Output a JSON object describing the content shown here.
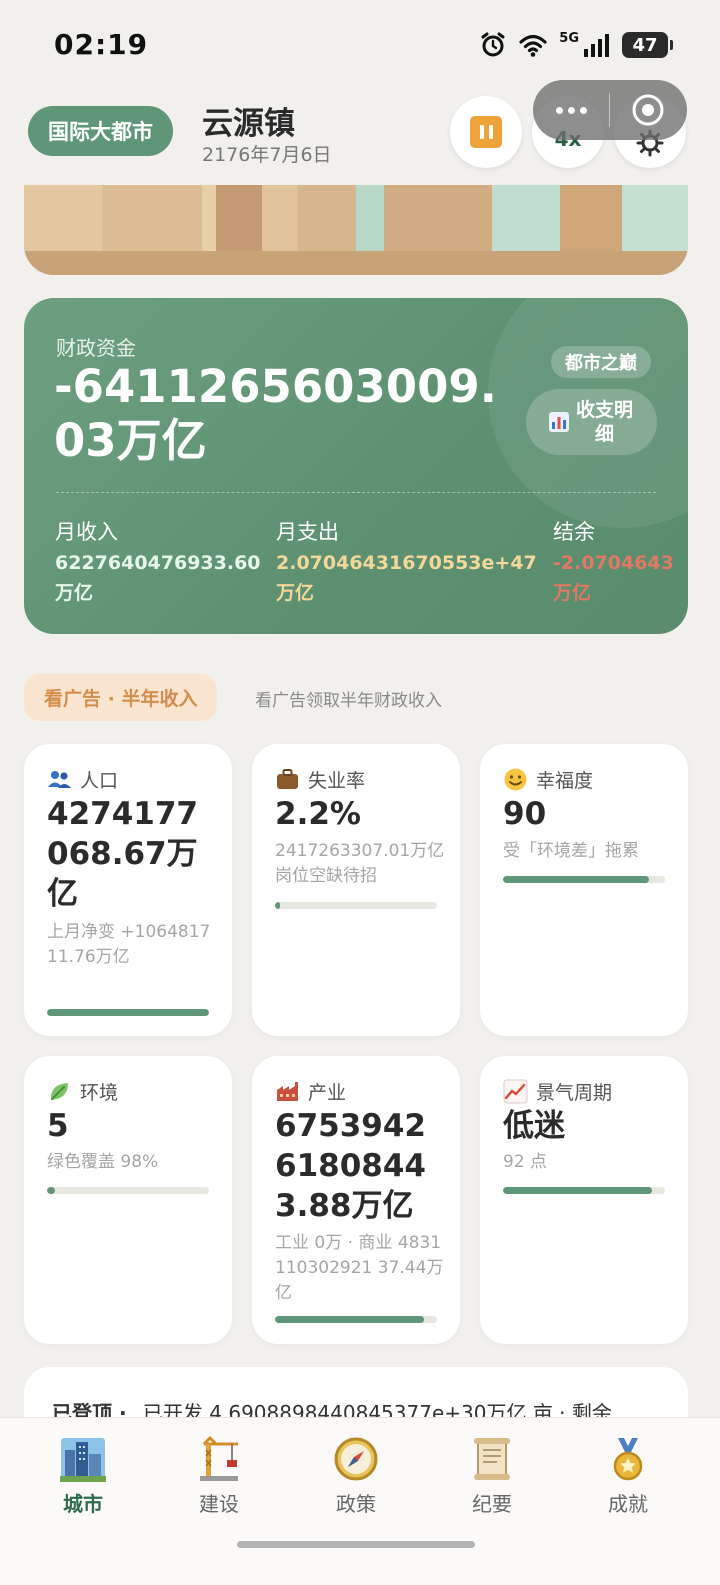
{
  "status_bar": {
    "time": "02:19",
    "network": "5G",
    "battery": "47"
  },
  "header": {
    "city_level": "国际大都市",
    "city_name": "云源镇",
    "date": "2176年7月6日",
    "speed": "4x"
  },
  "finance": {
    "label": "财政资金",
    "amount": "-6411265603009.03万亿",
    "tier": "都市之巅",
    "detail_button": "收支明细",
    "income_label": "月收入",
    "income_value": "6227640476933.60",
    "income_unit": "万亿",
    "expense_label": "月支出",
    "expense_value": "2.07046431670553e+47",
    "expense_unit": "万亿",
    "balance_label": "结余",
    "balance_value": "-2.0704643",
    "balance_unit": "万亿"
  },
  "ad": {
    "button": "看广告 · 半年收入",
    "note": "看广告领取半年财政收入"
  },
  "stats": {
    "population": {
      "title": "人口",
      "value": "4274177068.67万亿",
      "sub": "上月净变 +106481711.76万亿",
      "progress": 1.0
    },
    "unemployment": {
      "title": "失业率",
      "value": "2.2%",
      "sub": "2417263307.01万亿 岗位空缺待招",
      "progress": 0.02
    },
    "happiness": {
      "title": "幸福度",
      "value": "90",
      "sub": "受「环境差」拖累",
      "progress": 0.9
    },
    "environment": {
      "title": "环境",
      "value": "5",
      "sub": "绿色覆盖 98%",
      "progress": 0.05
    },
    "industry": {
      "title": "产业",
      "value": "67539426180844 3.88万亿",
      "sub": "工业 0万 · 商业 4831110302921 37.44万亿",
      "progress": 0.92
    },
    "business_cycle": {
      "title": "景气周期",
      "value": "低迷",
      "sub": "92 点",
      "progress": 0.92
    }
  },
  "summary": {
    "prefix": "已登顶 ·",
    "text": "已开发 4.6908898440845377e+30万亿 亩 · 剩余"
  },
  "nav": {
    "city": "城市",
    "build": "建设",
    "policy": "政策",
    "chronicle": "纪要",
    "achievements": "成就"
  },
  "colors": {
    "primary_green": "#5e9677",
    "accent_orange": "#f0a23a",
    "ad_bg": "#f8e4cf",
    "ad_text": "#d38d4c",
    "expense_gold": "#f4d79a",
    "balance_red": "#e07a64"
  }
}
